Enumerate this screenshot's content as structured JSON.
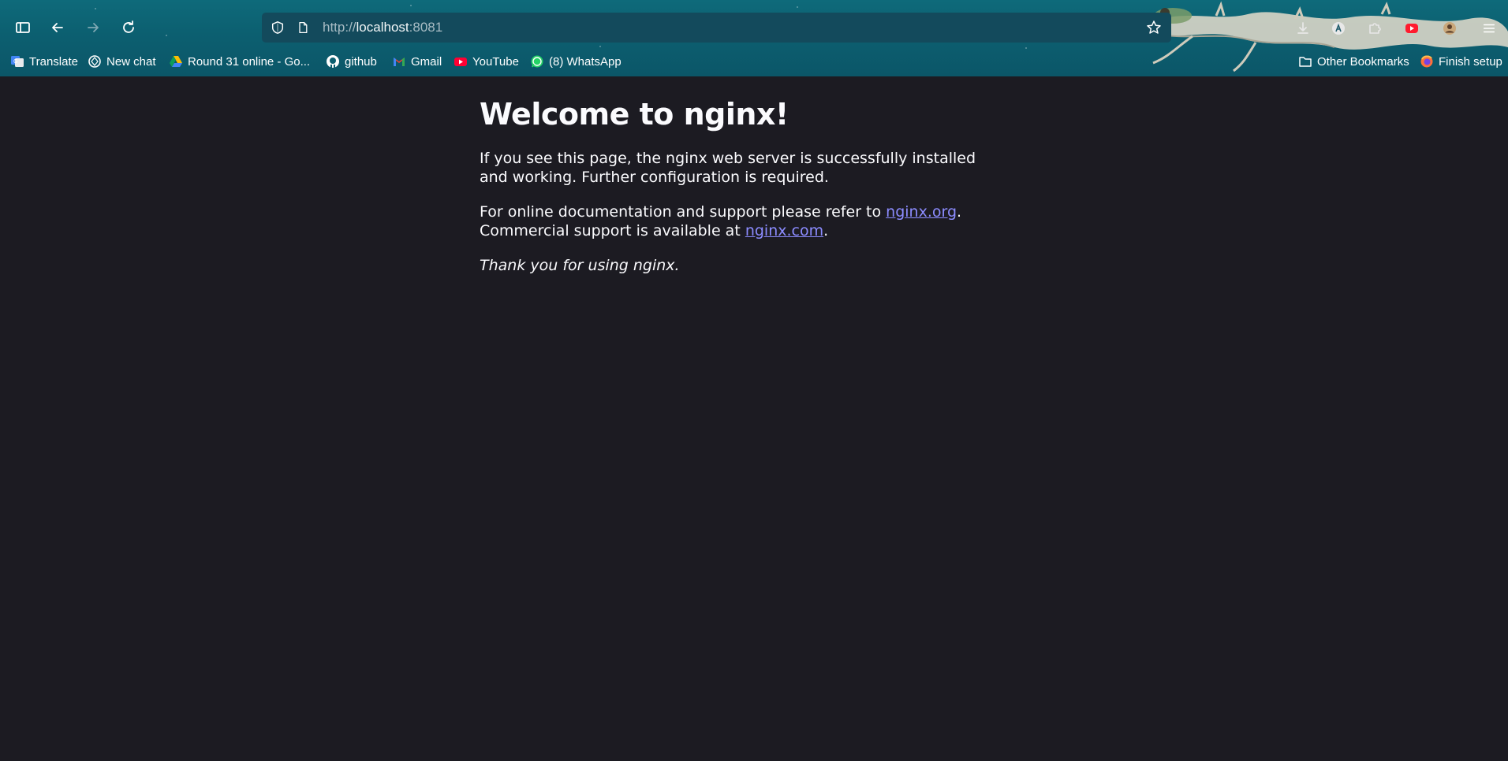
{
  "browser": {
    "url_scheme": "http://",
    "url_host": "localhost",
    "url_port": ":8081",
    "bookmarks": [
      {
        "label": "Translate",
        "icon": "google-translate-icon"
      },
      {
        "label": "New chat",
        "icon": "chatgpt-icon"
      },
      {
        "label": "Round 31 online - Go...",
        "icon": "google-drive-icon"
      },
      {
        "label": "github",
        "icon": "github-icon"
      },
      {
        "label": "Gmail",
        "icon": "gmail-icon"
      },
      {
        "label": "YouTube",
        "icon": "youtube-icon"
      },
      {
        "label": "(8) WhatsApp",
        "icon": "whatsapp-icon"
      }
    ],
    "other_bookmarks": "Other Bookmarks",
    "finish_setup": "Finish setup"
  },
  "page": {
    "heading": "Welcome to nginx!",
    "p1": "If you see this page, the nginx web server is successfully installed and working. Further configuration is required.",
    "p2_prefix": "For online documentation and support please refer to ",
    "p2_link1": "nginx.org",
    "p2_mid": ".",
    "p2_line2_prefix": "Commercial support is available at ",
    "p2_link2": "nginx.com",
    "p2_suffix": ".",
    "p3": "Thank you for using nginx."
  },
  "colors": {
    "page_background": "#1c1b22",
    "text": "#fbfbfe",
    "link": "#8c8cff",
    "toolbar": "#0c5f70",
    "urlbar": "#134a5c"
  }
}
